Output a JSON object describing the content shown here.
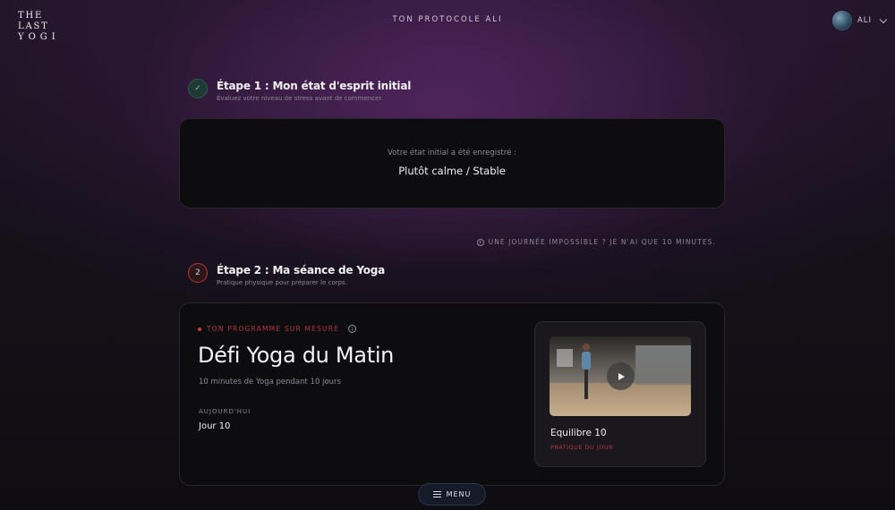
{
  "header": {
    "logo_line1": "THE LAST",
    "logo_line2": "YOGI",
    "title": "TON PROTOCOLE ALI",
    "user_name": "ALI"
  },
  "step1": {
    "badge": "✓",
    "title": "Étape 1 : Mon état d'esprit initial",
    "subtitle": "Évaluez votre niveau de stress avant de commencer.",
    "state_label": "Votre état initial a été enregistré :",
    "state_value": "Plutôt calme / Stable"
  },
  "notice": "UNE JOURNÉE IMPOSSIBLE ? JE N'AI QUE 10 MINUTES.",
  "step2": {
    "badge": "2",
    "title": "Étape 2 : Ma séance de Yoga",
    "subtitle": "Pratique physique pour préparer le corps."
  },
  "program": {
    "tag": "TON PROGRAMME SUR MESURE",
    "info_icon": "i",
    "title": "Défi Yoga du Matin",
    "subtitle": "10 minutes de Yoga pendant 10 jours",
    "today_label": "AUJOURD'HUI",
    "today_value": "Jour 10",
    "session_title": "Equilibre 10",
    "session_subtitle": "PRATIQUE DU JOUR"
  },
  "menu": {
    "label": "MENU"
  },
  "colors": {
    "accent_red": "#b7363f",
    "check_green": "#67d3b0",
    "card_bg": "#0d0c0f"
  }
}
